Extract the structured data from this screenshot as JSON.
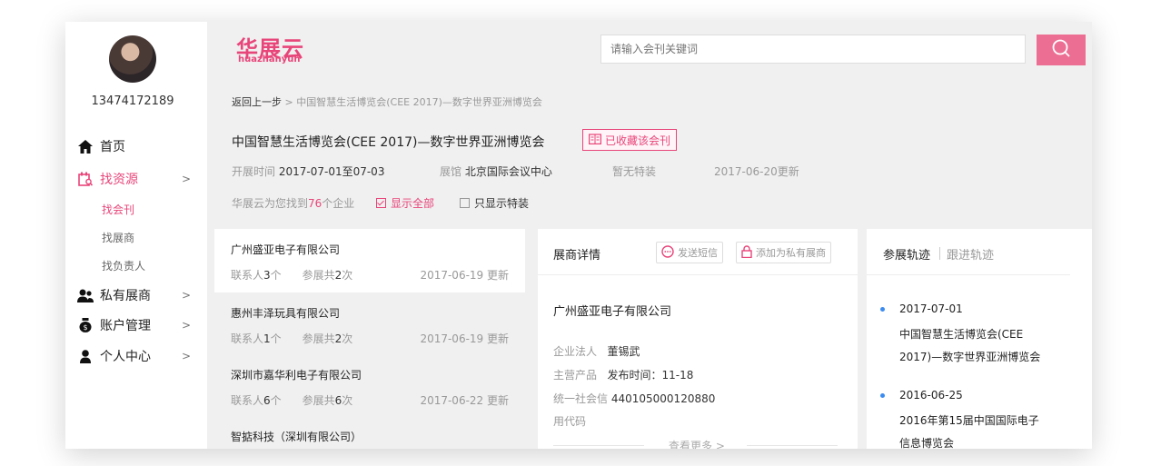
{
  "sidebar": {
    "phone": "13474172189",
    "nav": [
      {
        "label": "首页",
        "icon": "home-icon"
      },
      {
        "label": "找资源",
        "icon": "resource-icon",
        "chevron": ">"
      },
      {
        "label": "私有展商",
        "icon": "users-icon",
        "chevron": ">"
      },
      {
        "label": "账户管理",
        "icon": "wallet-icon",
        "chevron": ">"
      },
      {
        "label": "个人中心",
        "icon": "user-icon",
        "chevron": ">"
      }
    ],
    "sub": [
      "找会刊",
      "找展商",
      "找负责人"
    ]
  },
  "header": {
    "logo_cn": "华展云",
    "logo_en": "huazhanyun",
    "search_placeholder": "请输入会刊关键词"
  },
  "breadcrumb": {
    "back": "返回上一步",
    "sep": ">",
    "current": "中国智慧生活博览会(CEE 2017)—数字世界亚洲博览会"
  },
  "event": {
    "title": "中国智慧生活博览会(CEE 2017)—数字世界亚洲博览会",
    "fav_label": "已收藏该会刊",
    "date_label": "开展时间",
    "date_value": "2017-07-01至07-03",
    "venue_label": "展馆",
    "venue_value": "北京国际会议中心",
    "special": "暂无特装",
    "updated": "2017-06-20更新",
    "found_prefix": "华展云为您找到",
    "found_count": "76",
    "found_suffix": "个企业",
    "show_all": "显示全部",
    "special_only": "只显示特装"
  },
  "companies": [
    {
      "name": "广州盛亚电子有限公司",
      "contacts_label": "联系人",
      "contacts": "3",
      "contacts_unit": "个",
      "exhibit_label": "参展共",
      "exhibit": "2",
      "exhibit_unit": "次",
      "date": "2017-06-19 更新"
    },
    {
      "name": "惠州丰泽玩具有限公司",
      "contacts_label": "联系人",
      "contacts": "1",
      "contacts_unit": "个",
      "exhibit_label": "参展共",
      "exhibit": "2",
      "exhibit_unit": "次",
      "date": "2017-06-19 更新"
    },
    {
      "name": "深圳市嘉华利电子有限公司",
      "contacts_label": "联系人",
      "contacts": "6",
      "contacts_unit": "个",
      "exhibit_label": "参展共",
      "exhibit": "6",
      "exhibit_unit": "次",
      "date": "2017-06-22 更新"
    },
    {
      "name": "智掂科技（深圳有限公司）"
    }
  ],
  "detail": {
    "title": "展商详情",
    "sms": "发送短信",
    "add_private": "添加为私有展商",
    "company": "广州盛亚电子有限公司",
    "legal_label": "企业法人",
    "legal_value": "董锡武",
    "product_label": "主营产品",
    "product_value": "发布时间：11-18",
    "credit_label": "统一社会信",
    "credit_value": "440105000120880",
    "credit_label2": "用代码",
    "more": "查看更多 >"
  },
  "track": {
    "tab_active": "参展轨迹",
    "tab_other": "跟进轨迹",
    "items": [
      {
        "date": "2017-07-01",
        "line1": "中国智慧生活博览会(CEE",
        "line2": "2017)—数字世界亚洲博览会"
      },
      {
        "date": "2016-06-25",
        "line1": "2016年第15届中国国际电子",
        "line2": "信息博览会"
      }
    ]
  },
  "colors": {
    "accent": "#e8457a",
    "search_button": "#ec6f93",
    "timeline_dot": "#3b8cf0"
  }
}
